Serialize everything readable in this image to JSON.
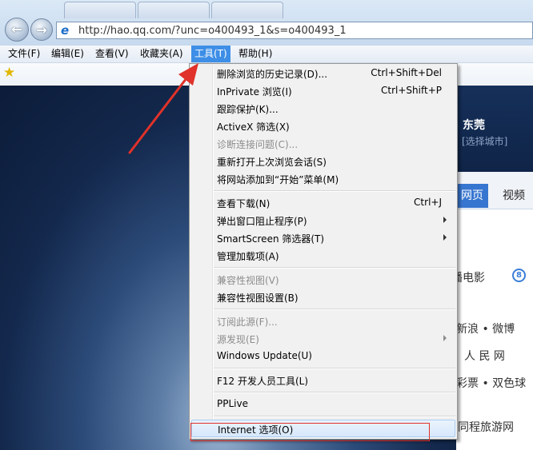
{
  "browser": {
    "address": "http://hao.qq.com/?unc=o400493_1&s=o400493_1",
    "back_glyph": "←",
    "forward_glyph": "→",
    "ie_glyph": "e",
    "star_glyph": "★"
  },
  "menubar": {
    "file": "文件(F)",
    "edit": "编辑(E)",
    "view": "查看(V)",
    "favorites": "收藏夹(A)",
    "tools": "工具(T)",
    "help": "帮助(H)"
  },
  "tools_menu": [
    {
      "label": "删除浏览的历史记录(D)...",
      "shortcut": "Ctrl+Shift+Del"
    },
    {
      "label": "InPrivate 浏览(I)",
      "shortcut": "Ctrl+Shift+P"
    },
    {
      "label": "跟踪保护(K)..."
    },
    {
      "label": "ActiveX 筛选(X)"
    },
    {
      "label": "诊断连接问题(C)...",
      "disabled": true
    },
    {
      "label": "重新打开上次浏览会话(S)"
    },
    {
      "label": "将网站添加到“开始”菜单(M)"
    },
    {
      "label": "查看下载(N)",
      "shortcut": "Ctrl+J"
    },
    {
      "label": "弹出窗口阻止程序(P)",
      "submenu": true
    },
    {
      "label": "SmartScreen 筛选器(T)",
      "submenu": true
    },
    {
      "label": "管理加载项(A)"
    },
    {
      "label": "兼容性视图(V)",
      "disabled": true
    },
    {
      "label": "兼容性视图设置(B)"
    },
    {
      "label": "订阅此源(F)...",
      "disabled": true
    },
    {
      "label": "源发现(E)",
      "disabled": true,
      "submenu": true
    },
    {
      "label": "Windows Update(U)"
    },
    {
      "label": "F12 开发人员工具(L)"
    },
    {
      "label": "PPLive"
    },
    {
      "label": "Internet 选项(O)",
      "highlighted": true
    }
  ],
  "page": {
    "city": "东莞",
    "city_select": "[选择城市]",
    "tab_web": "网页",
    "tab_video": "视频",
    "movie_text": "播电影",
    "movie_icon": "8",
    "links": [
      "新浪 • 微博",
      "人 民 网",
      "彩票 • 双色球",
      "同程旅游网"
    ]
  },
  "colors": {
    "annotation_red": "#e0322a",
    "menu_active": "#3d8ee6"
  }
}
